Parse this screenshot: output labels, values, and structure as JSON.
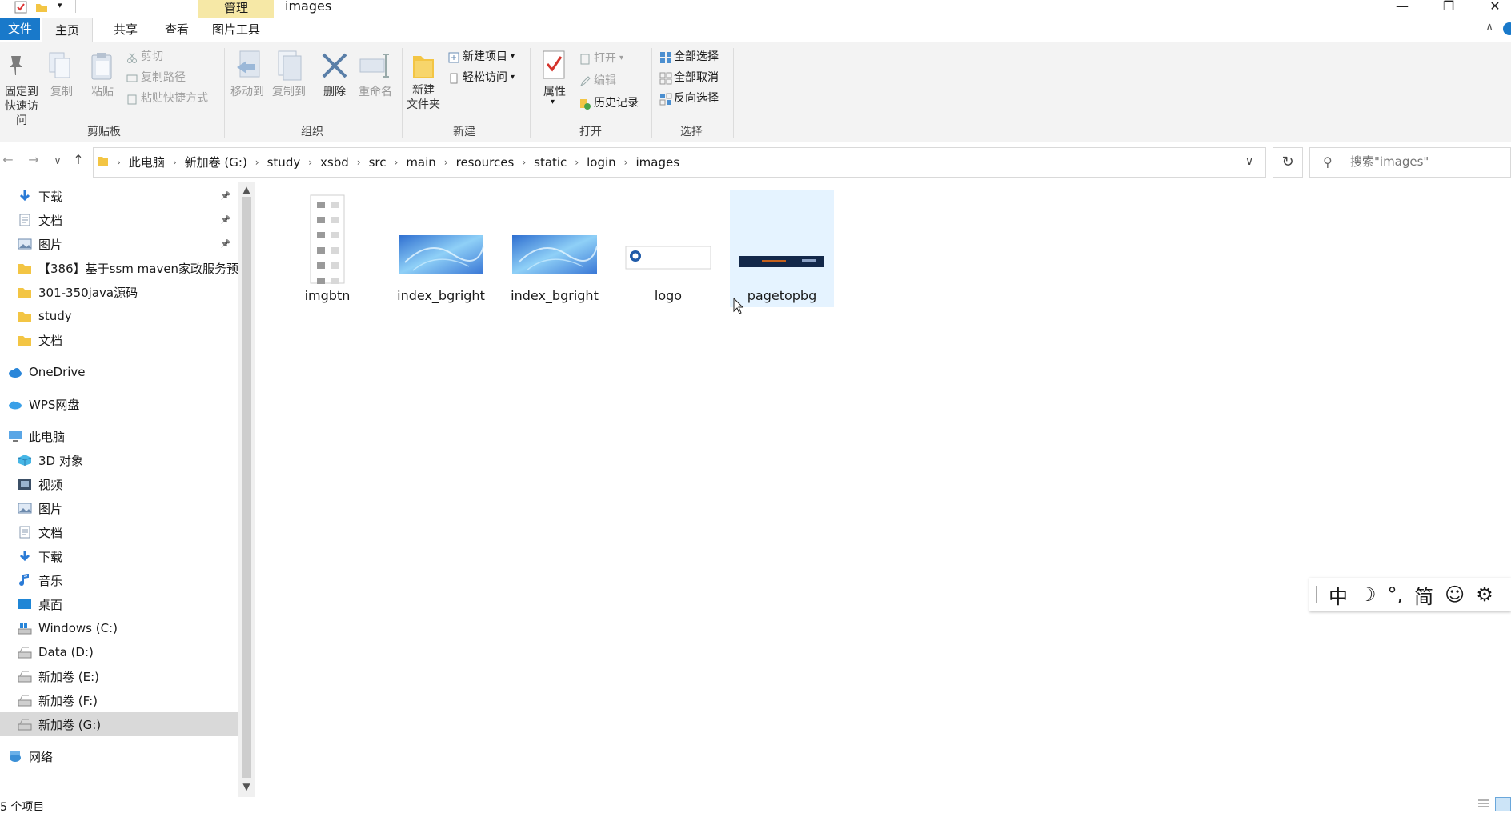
{
  "window": {
    "title": "images",
    "context_tab": "管理",
    "minimize": "—",
    "restore": "❐",
    "close": "✕"
  },
  "ribbon_tabs": {
    "file": "文件",
    "home": "主页",
    "share": "共享",
    "view": "查看",
    "picture_tools": "图片工具"
  },
  "ribbon": {
    "clipboard": {
      "label": "剪贴板",
      "pin_quick_access": [
        "固定到",
        "快速访问"
      ],
      "copy": "复制",
      "paste": "粘贴",
      "cut": "剪切",
      "copy_path": "复制路径",
      "paste_shortcut": "粘贴快捷方式"
    },
    "organize": {
      "label": "组织",
      "move_to": "移动到",
      "copy_to": "复制到",
      "delete": "删除",
      "rename": "重命名"
    },
    "new": {
      "label": "新建",
      "new_folder": [
        "新建",
        "文件夹"
      ],
      "new_item": "新建项目",
      "easy_access": "轻松访问"
    },
    "open": {
      "label": "打开",
      "properties": "属性",
      "open": "打开",
      "edit": "编辑",
      "history": "历史记录"
    },
    "select": {
      "label": "选择",
      "select_all": "全部选择",
      "select_none": "全部取消",
      "invert": "反向选择"
    }
  },
  "address": {
    "crumbs": [
      "此电脑",
      "新加卷 (G:)",
      "study",
      "xsbd",
      "src",
      "main",
      "resources",
      "static",
      "login",
      "images"
    ],
    "search_placeholder": "搜索\"images\""
  },
  "nav_pane": {
    "quick_access": [
      {
        "label": "下载",
        "icon": "download-arrow-icon",
        "pinned": true
      },
      {
        "label": "文档",
        "icon": "document-icon",
        "pinned": true
      },
      {
        "label": "图片",
        "icon": "picture-icon",
        "pinned": true
      },
      {
        "label": "【386】基于ssm maven家政服务预约",
        "icon": "folder-icon",
        "pinned": false
      },
      {
        "label": "301-350java源码",
        "icon": "folder-icon",
        "pinned": false
      },
      {
        "label": "study",
        "icon": "folder-icon",
        "pinned": false
      },
      {
        "label": "文档",
        "icon": "folder-icon",
        "pinned": false
      }
    ],
    "onedrive": "OneDrive",
    "wps": "WPS网盘",
    "this_pc": "此电脑",
    "pc_items": [
      {
        "label": "3D 对象",
        "icon": "3d-objects-icon"
      },
      {
        "label": "视频",
        "icon": "video-icon"
      },
      {
        "label": "图片",
        "icon": "picture-icon"
      },
      {
        "label": "文档",
        "icon": "document-icon"
      },
      {
        "label": "下载",
        "icon": "download-arrow-icon"
      },
      {
        "label": "音乐",
        "icon": "music-note-icon"
      },
      {
        "label": "桌面",
        "icon": "desktop-icon"
      },
      {
        "label": "Windows (C:)",
        "icon": "windows-drive-icon"
      },
      {
        "label": "Data (D:)",
        "icon": "drive-icon"
      },
      {
        "label": "新加卷 (E:)",
        "icon": "drive-icon"
      },
      {
        "label": "新加卷 (F:)",
        "icon": "drive-icon"
      },
      {
        "label": "新加卷 (G:)",
        "icon": "drive-icon",
        "selected": true
      }
    ],
    "network": "网络"
  },
  "files": [
    {
      "name": "imgbtn",
      "thumb": "imgbtn"
    },
    {
      "name": "index_bgright",
      "thumb": "blue"
    },
    {
      "name": "index_bgright",
      "thumb": "blue"
    },
    {
      "name": "logo",
      "thumb": "logo"
    },
    {
      "name": "pagetopbg",
      "thumb": "navy",
      "hover": true
    }
  ],
  "ime": {
    "mode": "中",
    "moon": "☽",
    "punct": "°,",
    "simplified": "简",
    "emoji": "☺",
    "settings": "⚙"
  },
  "status": {
    "count": "5 个项目"
  },
  "colors": {
    "accent": "#1979ca",
    "context_tab": "#f6e8a6",
    "hover": "#e5f3ff",
    "selected": "#d9d9d9"
  }
}
